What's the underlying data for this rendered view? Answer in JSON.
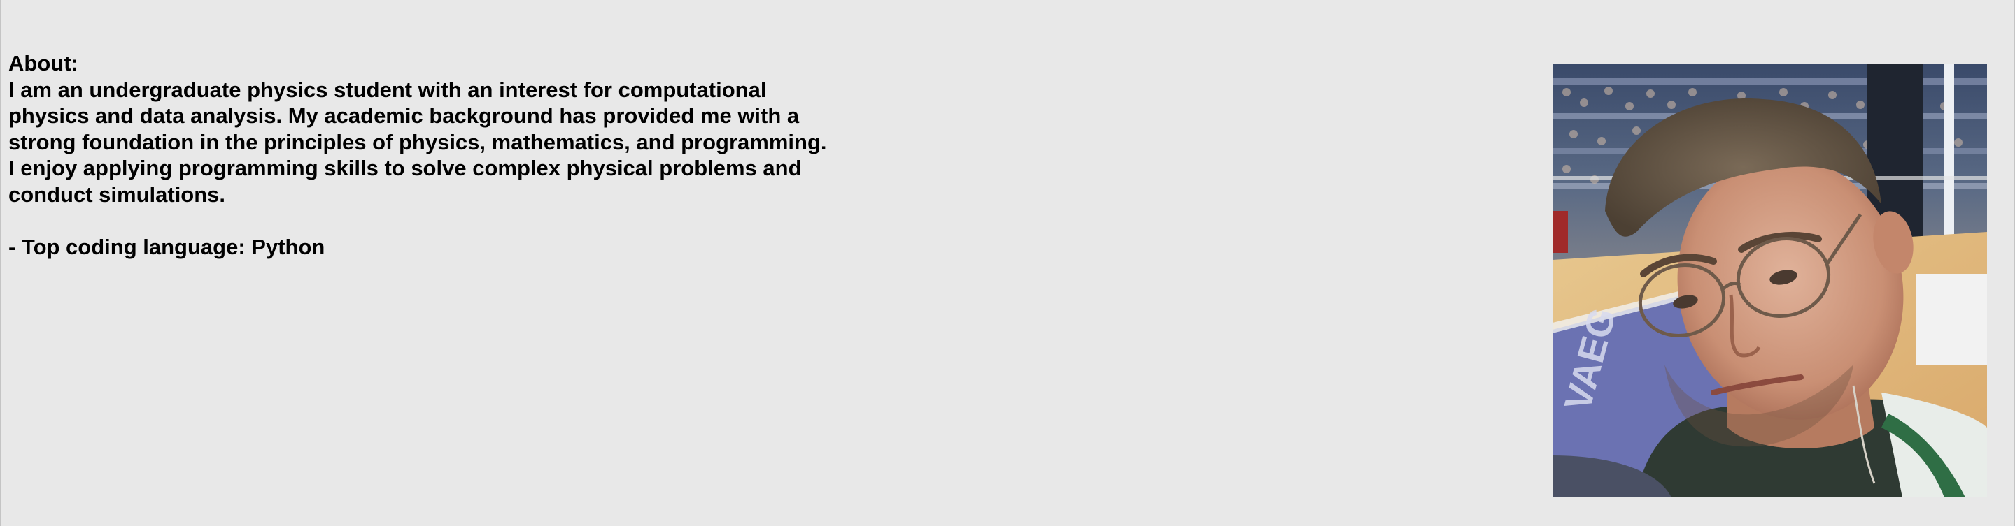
{
  "about": {
    "heading": "About:",
    "lines": [
      "I am an undergraduate physics student with an interest for computational",
      "physics and data analysis. My academic background has provided me with a",
      "strong foundation in the principles of physics, mathematics, and programming.",
      "I enjoy applying programming skills to solve complex physical problems and",
      "conduct simulations."
    ],
    "top_language": "- Top coding language: Python"
  },
  "photo": {
    "icon": "profile-photo"
  }
}
